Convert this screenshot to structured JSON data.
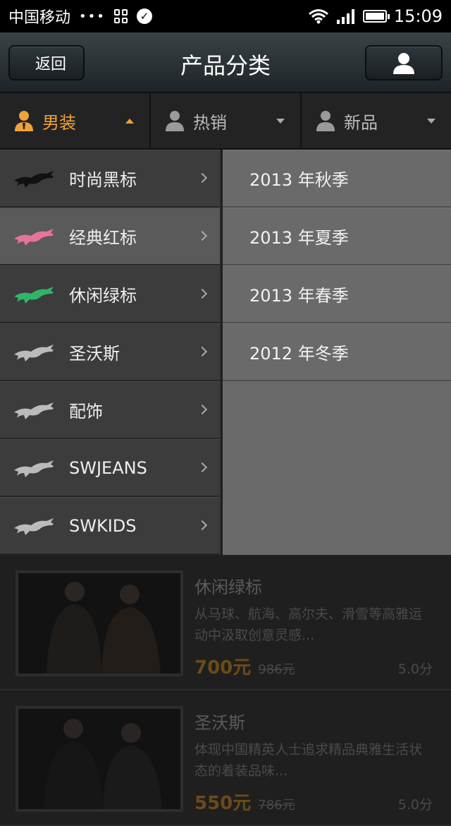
{
  "status_bar": {
    "carrier": "中国移动",
    "dots": "•••",
    "time": "15:09"
  },
  "nav": {
    "back_label": "返回",
    "title": "产品分类"
  },
  "tabs": [
    {
      "label": "男装",
      "active": true
    },
    {
      "label": "热销",
      "active": false
    },
    {
      "label": "新品",
      "active": false
    }
  ],
  "categories": [
    {
      "label": "时尚黑标",
      "logo_color": "#111111"
    },
    {
      "label": "经典红标",
      "logo_color": "#e8739a",
      "selected": true
    },
    {
      "label": "休闲绿标",
      "logo_color": "#2fb56a"
    },
    {
      "label": "圣沃斯",
      "logo_color": "#bbbbbb"
    },
    {
      "label": "配饰",
      "logo_color": "#bbbbbb"
    },
    {
      "label": "SWJEANS",
      "logo_color": "#bbbbbb"
    },
    {
      "label": "SWKIDS",
      "logo_color": "#bbbbbb"
    }
  ],
  "subcategories": [
    "2013 年秋季",
    "2013 年夏季",
    "2013 年春季",
    "2012 年冬季"
  ],
  "products": [
    {
      "name": "休闲绿标",
      "desc": "从马球、航海、高尔夫、滑雪等高雅运动中汲取创意灵感...",
      "price": "700元",
      "old_price": "986元",
      "rating": "5.0分"
    },
    {
      "name": "圣沃斯",
      "desc": "体现中国精英人士追求精品典雅生活状态的着装品味...",
      "price": "550元",
      "old_price": "786元",
      "rating": "5.0分"
    }
  ],
  "colors": {
    "accent": "#f0a23a"
  }
}
